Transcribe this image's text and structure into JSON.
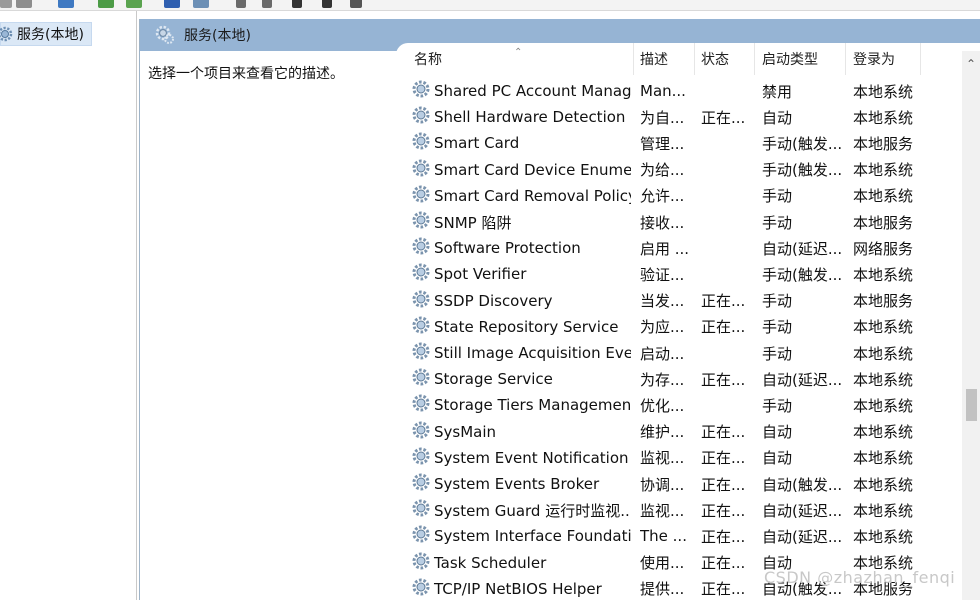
{
  "tree": {
    "item_label": "服务(本地)"
  },
  "header": {
    "title": "服务(本地)"
  },
  "description_hint": "选择一个项目来查看它的描述。",
  "columns": {
    "name": "名称",
    "desc": "描述",
    "status": "状态",
    "startup": "启动类型",
    "logon": "登录为"
  },
  "rows": [
    {
      "name": "Shared PC Account Manager",
      "desc": "Man...",
      "status": "",
      "startup": "禁用",
      "logon": "本地系统"
    },
    {
      "name": "Shell Hardware Detection",
      "desc": "为自...",
      "status": "正在...",
      "startup": "自动",
      "logon": "本地系统"
    },
    {
      "name": "Smart Card",
      "desc": "管理...",
      "status": "",
      "startup": "手动(触发...",
      "logon": "本地服务"
    },
    {
      "name": "Smart Card Device Enumer...",
      "desc": "为给...",
      "status": "",
      "startup": "手动(触发...",
      "logon": "本地系统"
    },
    {
      "name": "Smart Card Removal Policy",
      "desc": "允许...",
      "status": "",
      "startup": "手动",
      "logon": "本地系统"
    },
    {
      "name": "SNMP 陷阱",
      "desc": "接收...",
      "status": "",
      "startup": "手动",
      "logon": "本地服务"
    },
    {
      "name": "Software Protection",
      "desc": "启用 ...",
      "status": "",
      "startup": "自动(延迟...",
      "logon": "网络服务"
    },
    {
      "name": "Spot Verifier",
      "desc": "验证...",
      "status": "",
      "startup": "手动(触发...",
      "logon": "本地系统"
    },
    {
      "name": "SSDP Discovery",
      "desc": "当发...",
      "status": "正在...",
      "startup": "手动",
      "logon": "本地服务"
    },
    {
      "name": "State Repository Service",
      "desc": "为应...",
      "status": "正在...",
      "startup": "手动",
      "logon": "本地系统"
    },
    {
      "name": "Still Image Acquisition Eve...",
      "desc": "启动...",
      "status": "",
      "startup": "手动",
      "logon": "本地系统"
    },
    {
      "name": "Storage Service",
      "desc": "为存...",
      "status": "正在...",
      "startup": "自动(延迟...",
      "logon": "本地系统"
    },
    {
      "name": "Storage Tiers Management",
      "desc": "优化...",
      "status": "",
      "startup": "手动",
      "logon": "本地系统"
    },
    {
      "name": "SysMain",
      "desc": "维护...",
      "status": "正在...",
      "startup": "自动",
      "logon": "本地系统"
    },
    {
      "name": "System Event Notification ...",
      "desc": "监视...",
      "status": "正在...",
      "startup": "自动",
      "logon": "本地系统"
    },
    {
      "name": "System Events Broker",
      "desc": "协调...",
      "status": "正在...",
      "startup": "自动(触发...",
      "logon": "本地系统"
    },
    {
      "name": "System Guard 运行时监视...",
      "desc": "监视...",
      "status": "正在...",
      "startup": "自动(延迟...",
      "logon": "本地系统"
    },
    {
      "name": "System Interface Foundati...",
      "desc": "The ...",
      "status": "正在...",
      "startup": "自动(延迟...",
      "logon": "本地系统"
    },
    {
      "name": "Task Scheduler",
      "desc": "使用...",
      "status": "正在...",
      "startup": "自动",
      "logon": "本地系统"
    },
    {
      "name": "TCP/IP NetBIOS Helper",
      "desc": "提供...",
      "status": "正在...",
      "startup": "自动(触发...",
      "logon": "本地服务"
    }
  ],
  "watermark": "CSDN @zhazhan_fenqi",
  "icons": {
    "service": "gear-icon",
    "sort": "sort-ascending-icon",
    "scroll_up": "scroll-up-arrow-icon"
  },
  "colors": {
    "header_band": "#96b4d4",
    "selection": "#dbe8f6"
  }
}
